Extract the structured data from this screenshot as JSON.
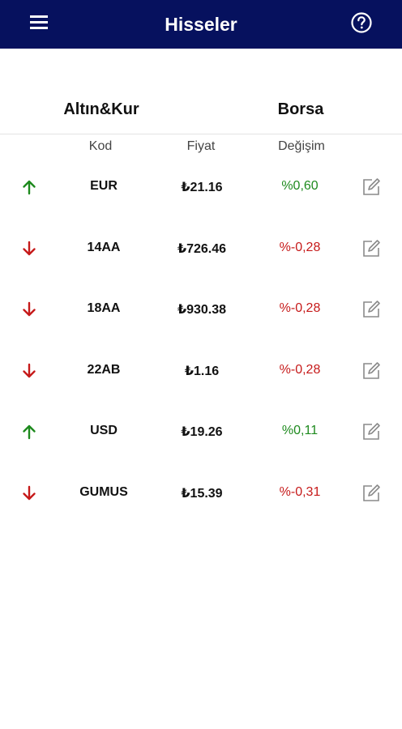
{
  "appbar": {
    "title": "Hisseler",
    "menu_icon": "menu-icon",
    "help_icon": "help-circle-icon",
    "background": "#06115e"
  },
  "tabs": [
    {
      "label": "Altın&Kur"
    },
    {
      "label": "Borsa"
    }
  ],
  "columns": {
    "kod": "Kod",
    "fiyat": "Fiyat",
    "degisim": "Değişim"
  },
  "colors": {
    "up": "#1e8a1e",
    "down": "#c61a1a"
  },
  "rows": [
    {
      "code": "EUR",
      "price": "₺21.16",
      "change": "%0,60",
      "direction": "up"
    },
    {
      "code": "14AA",
      "price": "₺726.46",
      "change": "%-0,28",
      "direction": "down"
    },
    {
      "code": "18AA",
      "price": "₺930.38",
      "change": "%-0,28",
      "direction": "down"
    },
    {
      "code": "22AB",
      "price": "₺1.16",
      "change": "%-0,28",
      "direction": "down"
    },
    {
      "code": "USD",
      "price": "₺19.26",
      "change": "%0,11",
      "direction": "up"
    },
    {
      "code": "GUMUS",
      "price": "₺15.39",
      "change": "%-0,31",
      "direction": "down"
    }
  ]
}
